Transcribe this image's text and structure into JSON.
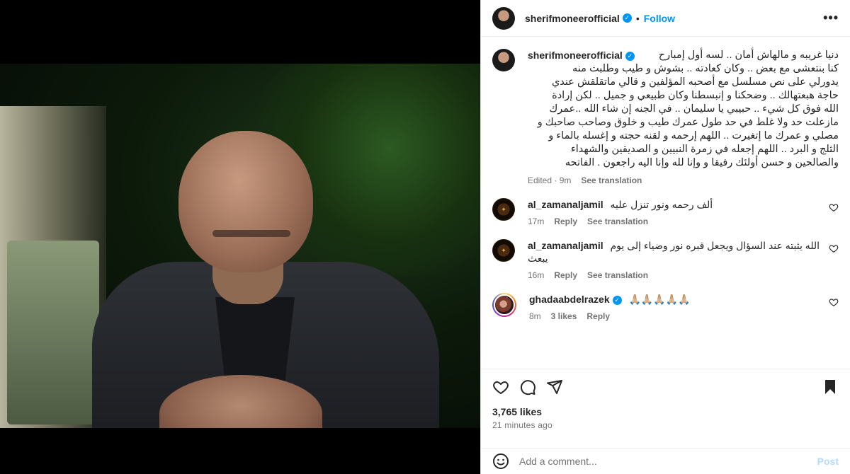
{
  "post": {
    "username": "sherifmoneerofficial",
    "follow_label": "Follow",
    "more_label": "•••",
    "dot": "•",
    "caption_lines": [
      "دنيا غريبه و مالهاش أمان .. لسه أول إمبارح",
      "كنا بنتعشى مع بعض .. وكان كعادته .. بشوش و طيب وطلبت منه",
      "يدورلي على نص مسلسل مع أصحبه المؤلفين و قالي ماتقلقش عندي",
      "حاجة هبعتهالك .. وضحكنا و إنبسطنا وكان طبيعي و جميل .. لكن إرادة",
      "الله فوق كل شيء .. حبيبي يا سليمان .. في الجنه إن شاء الله ..عمرك",
      "مازعلت حد ولا غلط في حد طول عمرك طيب و خلوق وصاحب صاحبك و",
      "مصلي و عمرك ما إتغيرت .. اللهم إرحمه و لقنه حجته و إغسله بالماء و",
      "الثلج و البرد .. اللهم إجعله في زمرة النبيين و الصديقين والشهداء",
      "والصالحين و حسن أولئك رفيقا و وإنا لله وإنا اليه راجعون . الفاتحه"
    ],
    "caption_meta": "Edited · 9m",
    "see_translation": "See translation",
    "likes": "3,765 likes",
    "posted_time": "21 minutes ago"
  },
  "comments": [
    {
      "username": "al_zamanaljamil",
      "text": "ألف رحمه ونور تنزل عليه",
      "time": "17m",
      "reply": "Reply",
      "see_translation": "See translation"
    },
    {
      "username": "al_zamanaljamil",
      "text": "الله يثبته عند السؤال ويجعل قبره نور وضياء إلى يوم يبعث",
      "time": "16m",
      "reply": "Reply",
      "see_translation": "See translation"
    },
    {
      "username": "ghadaabdelrazek",
      "text": "🙏🏼🙏🏼🙏🏼🙏🏼🙏🏼",
      "time": "8m",
      "likes": "3 likes",
      "reply": "Reply"
    }
  ],
  "add_comment": {
    "placeholder": "Add a comment...",
    "post_label": "Post"
  },
  "icons": {
    "like": "heart-icon",
    "comment": "comment-icon",
    "share": "share-icon",
    "save": "bookmark-icon",
    "emoji": "emoji-icon",
    "verified": "verified-badge-icon"
  },
  "colors": {
    "accent": "#0095f6",
    "post_disabled": "#b3dbff",
    "muted": "#737373"
  }
}
